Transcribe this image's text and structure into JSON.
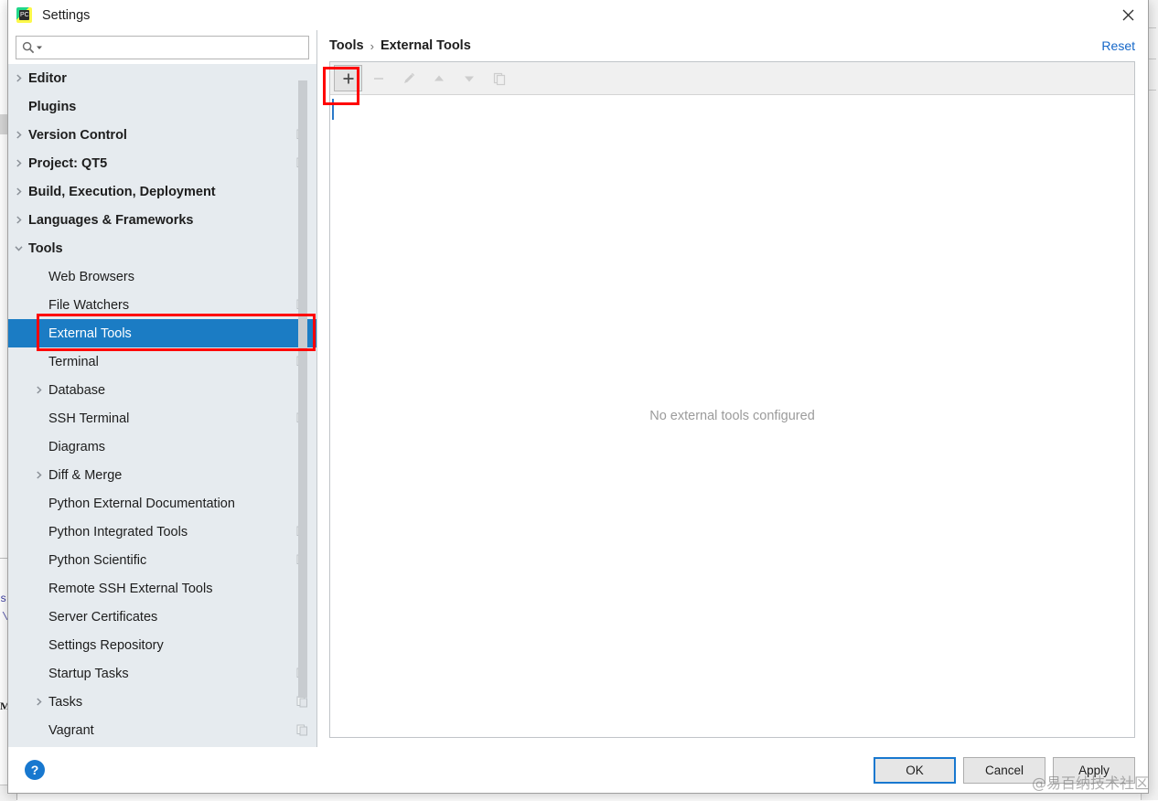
{
  "window": {
    "title": "Settings",
    "app_icon": "pycharm-logo-icon",
    "close_label": "×"
  },
  "search": {
    "value": "",
    "placeholder": "",
    "icon": "search-icon",
    "dropdown_icon": "chevron-down-icon"
  },
  "sidebar": {
    "items": [
      {
        "label": "Editor",
        "level": 0,
        "expandable": true,
        "expanded": false,
        "selected": false,
        "badge": false
      },
      {
        "label": "Plugins",
        "level": 0,
        "expandable": false,
        "expanded": false,
        "selected": false,
        "badge": false
      },
      {
        "label": "Version Control",
        "level": 0,
        "expandable": true,
        "expanded": false,
        "selected": false,
        "badge": true
      },
      {
        "label": "Project: QT5",
        "level": 0,
        "expandable": true,
        "expanded": false,
        "selected": false,
        "badge": true
      },
      {
        "label": "Build, Execution, Deployment",
        "level": 0,
        "expandable": true,
        "expanded": false,
        "selected": false,
        "badge": false
      },
      {
        "label": "Languages & Frameworks",
        "level": 0,
        "expandable": true,
        "expanded": false,
        "selected": false,
        "badge": false
      },
      {
        "label": "Tools",
        "level": 0,
        "expandable": true,
        "expanded": true,
        "selected": false,
        "badge": false
      },
      {
        "label": "Web Browsers",
        "level": 1,
        "expandable": false,
        "expanded": false,
        "selected": false,
        "badge": false
      },
      {
        "label": "File Watchers",
        "level": 1,
        "expandable": false,
        "expanded": false,
        "selected": false,
        "badge": true
      },
      {
        "label": "External Tools",
        "level": 1,
        "expandable": false,
        "expanded": false,
        "selected": true,
        "badge": false
      },
      {
        "label": "Terminal",
        "level": 1,
        "expandable": false,
        "expanded": false,
        "selected": false,
        "badge": true
      },
      {
        "label": "Database",
        "level": 1,
        "expandable": true,
        "expanded": false,
        "selected": false,
        "badge": false
      },
      {
        "label": "SSH Terminal",
        "level": 1,
        "expandable": false,
        "expanded": false,
        "selected": false,
        "badge": true
      },
      {
        "label": "Diagrams",
        "level": 1,
        "expandable": false,
        "expanded": false,
        "selected": false,
        "badge": false
      },
      {
        "label": "Diff & Merge",
        "level": 1,
        "expandable": true,
        "expanded": false,
        "selected": false,
        "badge": false
      },
      {
        "label": "Python External Documentation",
        "level": 1,
        "expandable": false,
        "expanded": false,
        "selected": false,
        "badge": false
      },
      {
        "label": "Python Integrated Tools",
        "level": 1,
        "expandable": false,
        "expanded": false,
        "selected": false,
        "badge": true
      },
      {
        "label": "Python Scientific",
        "level": 1,
        "expandable": false,
        "expanded": false,
        "selected": false,
        "badge": true
      },
      {
        "label": "Remote SSH External Tools",
        "level": 1,
        "expandable": false,
        "expanded": false,
        "selected": false,
        "badge": false
      },
      {
        "label": "Server Certificates",
        "level": 1,
        "expandable": false,
        "expanded": false,
        "selected": false,
        "badge": false
      },
      {
        "label": "Settings Repository",
        "level": 1,
        "expandable": false,
        "expanded": false,
        "selected": false,
        "badge": false
      },
      {
        "label": "Startup Tasks",
        "level": 1,
        "expandable": false,
        "expanded": false,
        "selected": false,
        "badge": true
      },
      {
        "label": "Tasks",
        "level": 1,
        "expandable": true,
        "expanded": false,
        "selected": false,
        "badge": true
      },
      {
        "label": "Vagrant",
        "level": 1,
        "expandable": false,
        "expanded": false,
        "selected": false,
        "badge": true
      }
    ]
  },
  "content": {
    "breadcrumb": [
      "Tools",
      "External Tools"
    ],
    "breadcrumb_separator": "›",
    "reset_label": "Reset",
    "empty_message": "No external tools configured",
    "toolbar": [
      {
        "name": "add-button",
        "icon": "plus-icon",
        "enabled": true,
        "pressed": true
      },
      {
        "name": "remove-button",
        "icon": "minus-icon",
        "enabled": false,
        "pressed": false
      },
      {
        "name": "edit-button",
        "icon": "pencil-icon",
        "enabled": false,
        "pressed": false
      },
      {
        "name": "move-up-button",
        "icon": "arrow-up-icon",
        "enabled": false,
        "pressed": false
      },
      {
        "name": "move-down-button",
        "icon": "arrow-down-icon",
        "enabled": false,
        "pressed": false
      },
      {
        "name": "copy-button",
        "icon": "copy-icon",
        "enabled": false,
        "pressed": false
      }
    ]
  },
  "footer": {
    "help_label": "?",
    "buttons": [
      {
        "label": "OK",
        "default": true
      },
      {
        "label": "Cancel",
        "default": false
      },
      {
        "label": "Apply",
        "default": false
      }
    ]
  },
  "annotations": {
    "accent_color": "#ff0000",
    "boxes": [
      "add-button-highlight",
      "external-tools-item-highlight"
    ]
  },
  "watermark": {
    "text": "@易百纳技术社区"
  },
  "background": {
    "fragments": [
      "s",
      "\\",
      "M"
    ]
  },
  "colors": {
    "selection_blue": "#1b7cc4",
    "link_blue": "#1567c8",
    "sidebar_bg": "#e6ebef",
    "toolbar_bg": "#f0f0f0",
    "annotation_red": "#ff0000"
  }
}
